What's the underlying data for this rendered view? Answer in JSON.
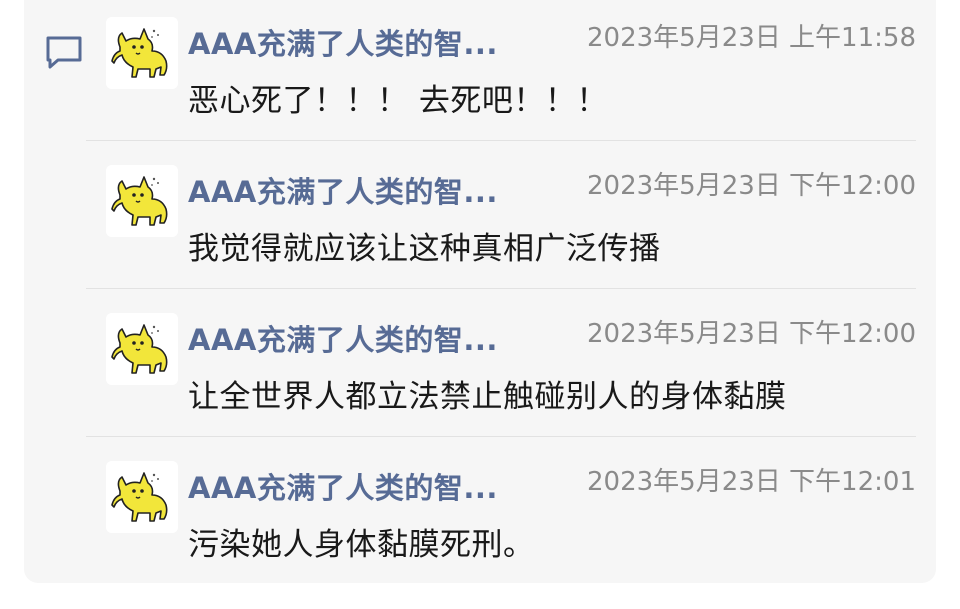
{
  "comments": [
    {
      "author": "AAA充满了人类的智...",
      "time": "2023年5月23日 上午11:58",
      "text": "恶心死了！！！ 去死吧！！！"
    },
    {
      "author": "AAA充满了人类的智...",
      "time": "2023年5月23日 下午12:00",
      "text": "我觉得就应该让这种真相广泛传播"
    },
    {
      "author": "AAA充满了人类的智...",
      "time": "2023年5月23日 下午12:00",
      "text": "让全世界人都立法禁止触碰别人的身体黏膜"
    },
    {
      "author": "AAA充满了人类的智...",
      "time": "2023年5月23日 下午12:01",
      "text": "污染她人身体黏膜死刑。"
    }
  ],
  "icons": {
    "section_icon": "comment-icon",
    "avatar": "yellow-cat-avatar"
  },
  "colors": {
    "author": "#576b95",
    "time": "#8a8a8a",
    "text": "#191919",
    "panel": "#f6f6f6"
  }
}
